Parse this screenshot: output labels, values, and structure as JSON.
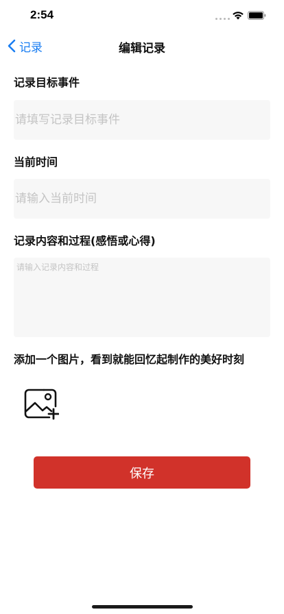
{
  "status_bar": {
    "time": "2:54"
  },
  "nav": {
    "back_label": "记录",
    "title": "编辑记录"
  },
  "form": {
    "target_event": {
      "label": "记录目标事件",
      "placeholder": "请填写记录目标事件",
      "value": ""
    },
    "current_time": {
      "label": "当前时间",
      "placeholder": "请输入当前时间",
      "value": ""
    },
    "content": {
      "label": "记录内容和过程(感悟或心得)",
      "placeholder": "请输入记录内容和过程",
      "value": ""
    },
    "image_section": {
      "label": "添加一个图片，看到就能回忆起制作的美好时刻",
      "icon": "add-image-icon"
    },
    "save_label": "保存"
  },
  "colors": {
    "accent": "#1a7ef2",
    "primary_button": "#d1322a",
    "input_background": "#f7f7f7",
    "placeholder": "#c4c4c4"
  }
}
